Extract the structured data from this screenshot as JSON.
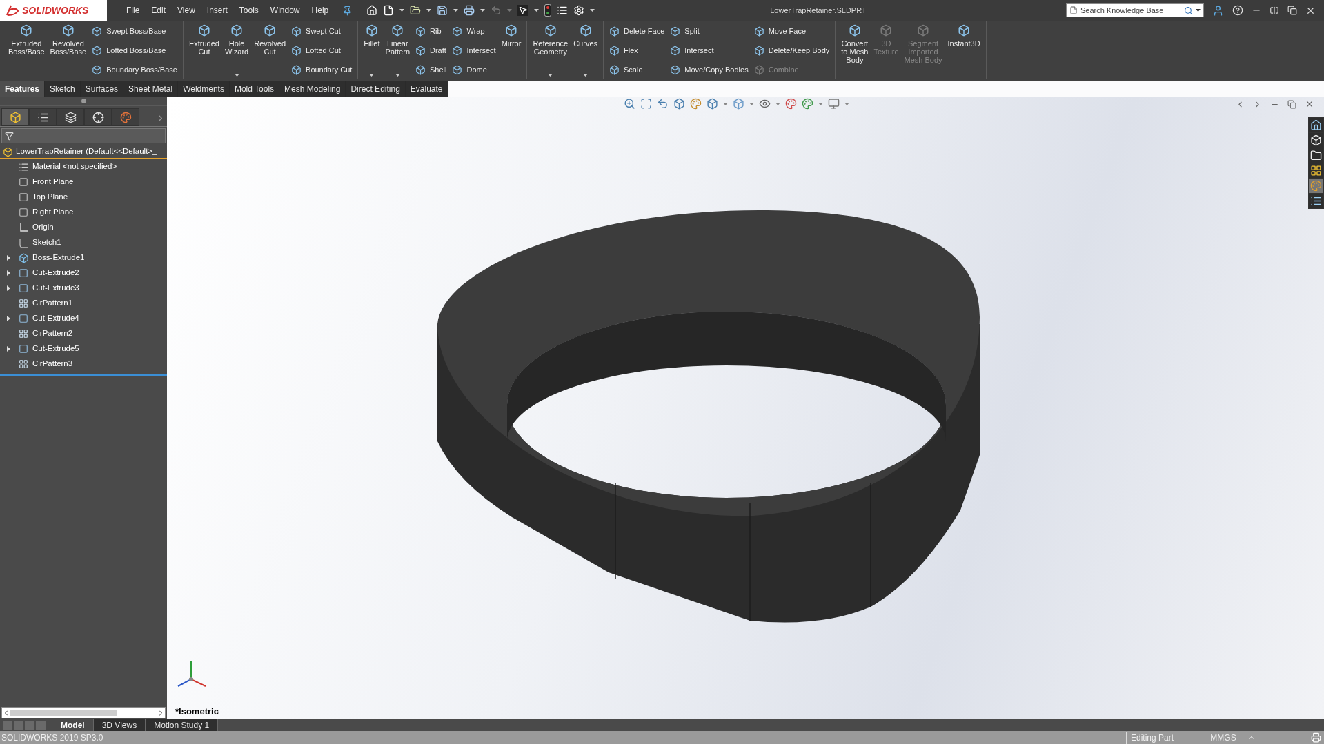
{
  "app": {
    "logo": "SOLIDWORKS",
    "title": "LowerTrapRetainer.SLDPRT",
    "search": {
      "placeholder": "Search Knowledge Base"
    }
  },
  "menu": [
    "File",
    "Edit",
    "View",
    "Insert",
    "Tools",
    "Window",
    "Help"
  ],
  "ribbon": {
    "groups": [
      {
        "items": [
          {
            "kind": "large",
            "label": "Extruded\nBoss/Base",
            "disabled": false,
            "dropdown": false
          },
          {
            "kind": "large",
            "label": "Revolved\nBoss/Base",
            "disabled": false,
            "dropdown": false
          },
          {
            "kind": "column",
            "entries": [
              {
                "label": "Swept Boss/Base",
                "disabled": false
              },
              {
                "label": "Lofted Boss/Base",
                "disabled": false
              },
              {
                "label": "Boundary Boss/Base",
                "disabled": false
              }
            ]
          }
        ]
      },
      {
        "items": [
          {
            "kind": "large",
            "label": "Extruded\nCut",
            "disabled": false,
            "dropdown": false
          },
          {
            "kind": "large",
            "label": "Hole\nWizard",
            "disabled": false,
            "dropdown": true
          },
          {
            "kind": "large",
            "label": "Revolved\nCut",
            "disabled": false,
            "dropdown": false
          },
          {
            "kind": "column",
            "entries": [
              {
                "label": "Swept Cut",
                "disabled": false
              },
              {
                "label": "Lofted Cut",
                "disabled": false
              },
              {
                "label": "Boundary Cut",
                "disabled": false
              }
            ]
          }
        ]
      },
      {
        "items": [
          {
            "kind": "large",
            "label": "Fillet",
            "disabled": false,
            "dropdown": true
          },
          {
            "kind": "large",
            "label": "Linear\nPattern",
            "disabled": false,
            "dropdown": true
          },
          {
            "kind": "column",
            "entries": [
              {
                "label": "Rib",
                "disabled": false
              },
              {
                "label": "Draft",
                "disabled": false
              },
              {
                "label": "Shell",
                "disabled": false
              }
            ]
          },
          {
            "kind": "column",
            "entries": [
              {
                "label": "Wrap",
                "disabled": false
              },
              {
                "label": "Intersect",
                "disabled": false
              },
              {
                "label": "Dome",
                "disabled": false
              }
            ]
          },
          {
            "kind": "large",
            "label": "Mirror",
            "disabled": false,
            "dropdown": false
          }
        ]
      },
      {
        "items": [
          {
            "kind": "large",
            "label": "Reference\nGeometry",
            "disabled": false,
            "dropdown": true
          },
          {
            "kind": "large",
            "label": "Curves",
            "disabled": false,
            "dropdown": true
          }
        ]
      },
      {
        "items": [
          {
            "kind": "column",
            "entries": [
              {
                "label": "Delete Face",
                "disabled": false
              },
              {
                "label": "Flex",
                "disabled": false
              },
              {
                "label": "Scale",
                "disabled": false
              }
            ]
          },
          {
            "kind": "column",
            "entries": [
              {
                "label": "Split",
                "disabled": false
              },
              {
                "label": "Intersect",
                "disabled": false
              },
              {
                "label": "Move/Copy Bodies",
                "disabled": false
              }
            ]
          },
          {
            "kind": "column",
            "entries": [
              {
                "label": "Move Face",
                "disabled": false
              },
              {
                "label": "Delete/Keep Body",
                "disabled": false
              },
              {
                "label": "Combine",
                "disabled": true
              }
            ]
          }
        ]
      },
      {
        "items": [
          {
            "kind": "large",
            "label": "Convert\nto Mesh\nBody",
            "disabled": false,
            "dropdown": false
          },
          {
            "kind": "large",
            "label": "3D\nTexture",
            "disabled": true,
            "dropdown": false
          },
          {
            "kind": "large",
            "label": "Segment\nImported\nMesh Body",
            "disabled": true,
            "dropdown": false
          },
          {
            "kind": "large",
            "label": "Instant3D",
            "disabled": false,
            "dropdown": false
          }
        ]
      }
    ]
  },
  "tabs": [
    {
      "label": "Features",
      "selected": true
    },
    {
      "label": "Sketch",
      "selected": false
    },
    {
      "label": "Surfaces",
      "selected": false
    },
    {
      "label": "Sheet Metal",
      "selected": false
    },
    {
      "label": "Weldments",
      "selected": false
    },
    {
      "label": "Mold Tools",
      "selected": false
    },
    {
      "label": "Mesh Modeling",
      "selected": false
    },
    {
      "label": "Direct Editing",
      "selected": false
    },
    {
      "label": "Evaluate",
      "selected": false
    }
  ],
  "panel_tabs": [
    {
      "kind": "feature",
      "selected": true
    },
    {
      "kind": "property",
      "selected": false
    },
    {
      "kind": "config",
      "selected": false
    },
    {
      "kind": "dimxpert",
      "selected": false
    },
    {
      "kind": "display",
      "selected": false
    }
  ],
  "tree": {
    "root": "LowerTrapRetainer  (Default<<Default>_",
    "items": [
      {
        "kind": "material",
        "label": "Material <not specified>",
        "expandable": false
      },
      {
        "kind": "plane",
        "label": "Front Plane",
        "expandable": false
      },
      {
        "kind": "plane",
        "label": "Top Plane",
        "expandable": false
      },
      {
        "kind": "plane",
        "label": "Right Plane",
        "expandable": false
      },
      {
        "kind": "origin",
        "label": "Origin",
        "expandable": false
      },
      {
        "kind": "sketch",
        "label": "Sketch1",
        "expandable": false
      },
      {
        "kind": "boss",
        "label": "Boss-Extrude1",
        "expandable": true
      },
      {
        "kind": "cut",
        "label": "Cut-Extrude2",
        "expandable": true
      },
      {
        "kind": "cut",
        "label": "Cut-Extrude3",
        "expandable": true
      },
      {
        "kind": "pattern",
        "label": "CirPattern1",
        "expandable": false
      },
      {
        "kind": "cut",
        "label": "Cut-Extrude4",
        "expandable": true
      },
      {
        "kind": "pattern",
        "label": "CirPattern2",
        "expandable": false
      },
      {
        "kind": "cut",
        "label": "Cut-Extrude5",
        "expandable": true
      },
      {
        "kind": "pattern",
        "label": "CirPattern3",
        "expandable": false
      }
    ]
  },
  "viewport": {
    "view_name": "*Isometric"
  },
  "bottom_tabs": [
    {
      "label": "Model",
      "selected": true
    },
    {
      "label": "3D Views",
      "selected": false
    },
    {
      "label": "Motion Study 1",
      "selected": false
    }
  ],
  "status_bar": {
    "version": "SOLIDWORKS 2019 SP3.0",
    "mode": "Editing Part",
    "units": "MMGS"
  }
}
